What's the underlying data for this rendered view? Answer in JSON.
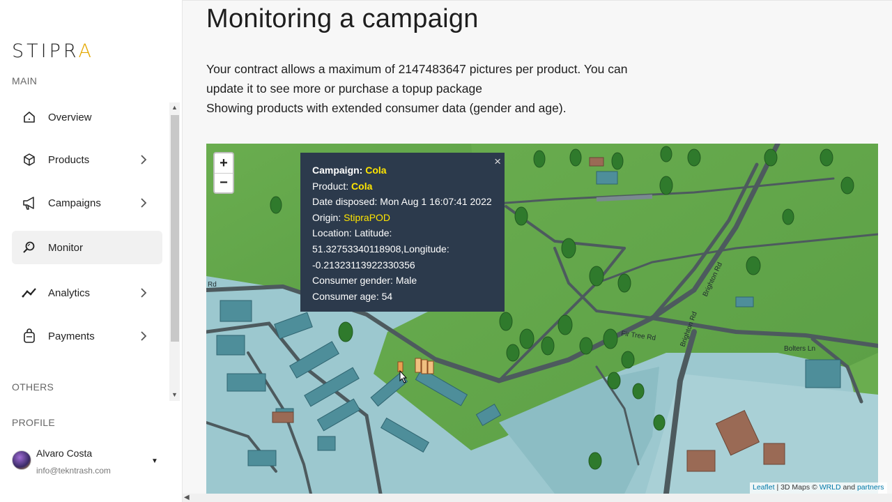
{
  "brand": {
    "logo_text": "STIPR",
    "logo_accent": "A"
  },
  "sidebar": {
    "section_main": "MAIN",
    "section_others": "OTHERS",
    "section_profile": "PROFILE",
    "items": [
      {
        "label": "Overview",
        "icon": "home-icon"
      },
      {
        "label": "Products",
        "icon": "box-icon"
      },
      {
        "label": "Campaigns",
        "icon": "megaphone-icon"
      },
      {
        "label": "Monitor",
        "icon": "search-icon",
        "active": true
      },
      {
        "label": "Analytics",
        "icon": "trend-icon"
      },
      {
        "label": "Payments",
        "icon": "bag-icon"
      }
    ]
  },
  "profile": {
    "name": "Alvaro Costa",
    "email": "info@tekntrash.com"
  },
  "main": {
    "title": "Monitoring a campaign",
    "desc_line1": "Your contract allows a maximum of 2147483647 pictures per product. You can",
    "desc_line2": "update it to see more or purchase a topup package",
    "desc_line3": "Showing products with extended consumer data (gender and age)."
  },
  "map": {
    "zoom_in": "+",
    "zoom_out": "−",
    "labels": {
      "fir_tree": "Fir Tree Rd",
      "brighton1": "Brighton Rd",
      "brighton2": "Brighton Rd",
      "bolters": "Bolters Ln",
      "left_rd": "Rd"
    },
    "attribution": {
      "leaflet": "Leaflet",
      "sep1": " | 3D Maps © ",
      "wrld": "WRLD",
      "and": " and ",
      "partners": "partners"
    }
  },
  "popup": {
    "close": "×",
    "campaign_label": "Campaign:",
    "campaign_value": "Cola",
    "product_label": "Product:",
    "product_value": "Cola",
    "date_line": "Date disposed: Mon Aug 1 16:07:41 2022",
    "origin_label": "Origin:",
    "origin_value": "StipraPOD",
    "location_line1": "Location: Latitude:",
    "location_line2": "51.32753340118908,Longitude:",
    "location_line3": "-0.21323113922330356",
    "gender_line": "Consumer gender: Male",
    "age_line": "Consumer age: 54"
  },
  "colors": {
    "popup_bg": "#2c3a4c",
    "highlight": "#ffe500",
    "active_nav": "#f1f1f1"
  }
}
